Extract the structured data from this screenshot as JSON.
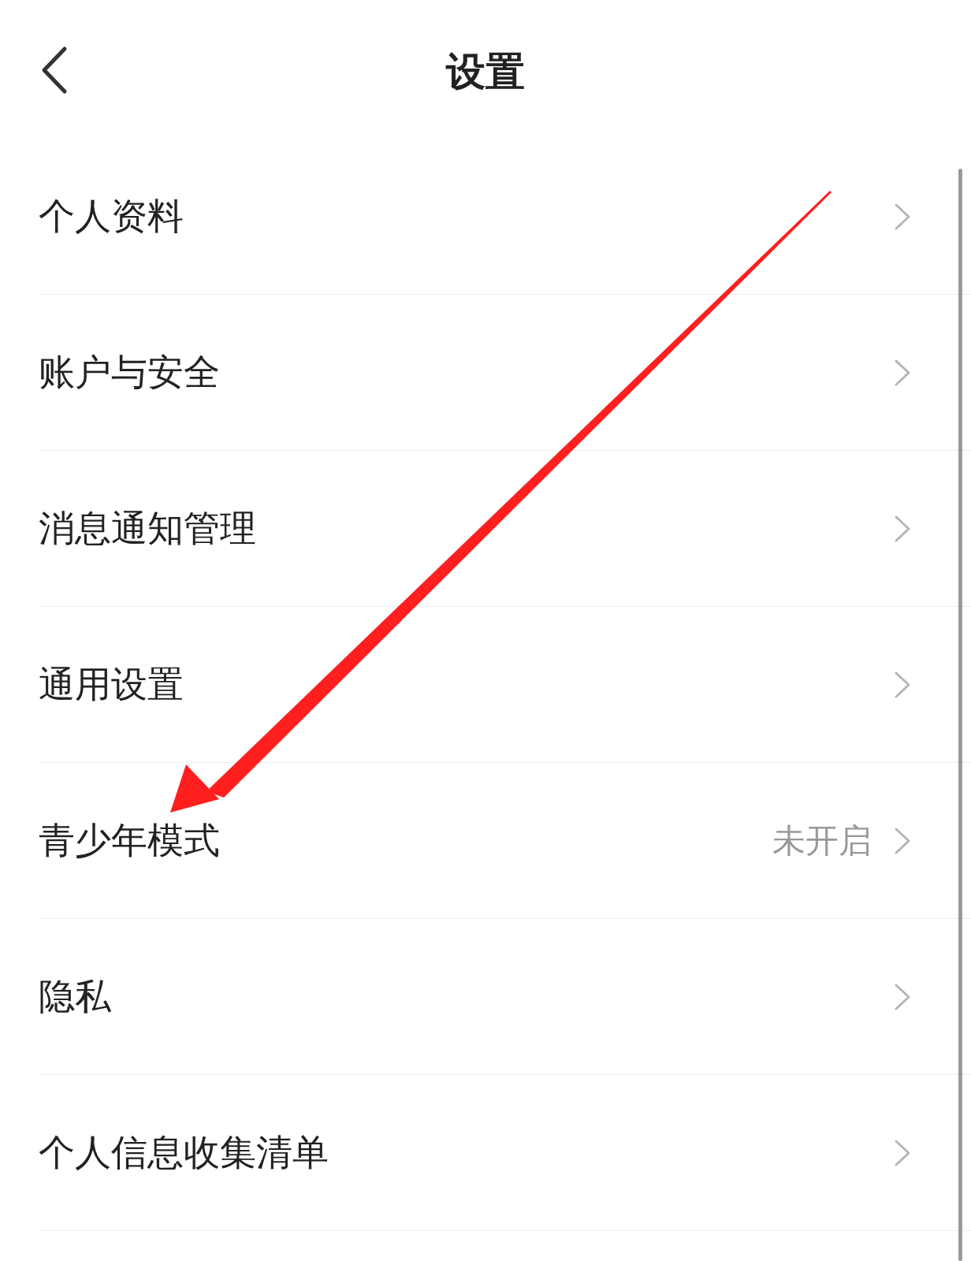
{
  "header": {
    "title": "设置"
  },
  "items": [
    {
      "label": "个人资料"
    },
    {
      "label": "账户与安全"
    },
    {
      "label": "消息通知管理"
    },
    {
      "label": "通用设置"
    },
    {
      "label": "青少年模式",
      "value": "未开启"
    },
    {
      "label": "隐私"
    },
    {
      "label": "个人信息收集清单"
    }
  ],
  "annotations": [
    {
      "kind": "arrow",
      "color": "#ff1f1f"
    }
  ]
}
